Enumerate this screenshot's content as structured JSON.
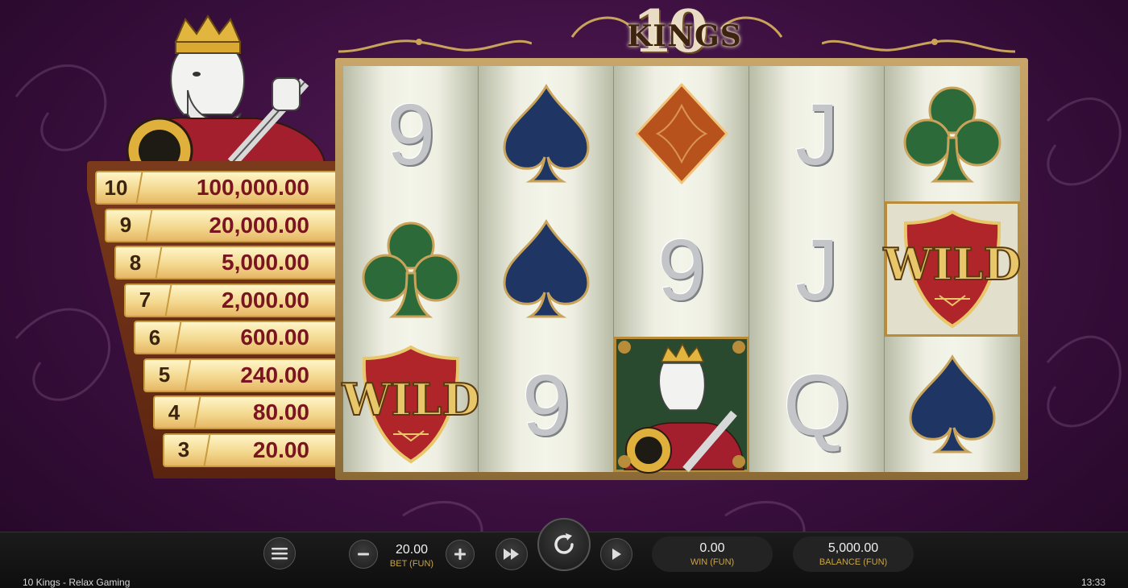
{
  "logo": {
    "number": "10",
    "word": "KINGS"
  },
  "paytable": [
    {
      "count": "10",
      "payout": "100,000.00"
    },
    {
      "count": "9",
      "payout": "20,000.00"
    },
    {
      "count": "8",
      "payout": "5,000.00"
    },
    {
      "count": "7",
      "payout": "2,000.00"
    },
    {
      "count": "6",
      "payout": "600.00"
    },
    {
      "count": "5",
      "payout": "240.00"
    },
    {
      "count": "4",
      "payout": "80.00"
    },
    {
      "count": "3",
      "payout": "20.00"
    }
  ],
  "reels": [
    [
      "9",
      "club",
      "wild"
    ],
    [
      "spade",
      "spade",
      "9"
    ],
    [
      "diamond",
      "9",
      "king"
    ],
    [
      "J",
      "J",
      "Q"
    ],
    [
      "club",
      "wild",
      "spade"
    ]
  ],
  "wild_label": "WILD",
  "symbol_colors": {
    "spade": "#1f3563",
    "club": "#2d6a3a",
    "diamond": "#b7521c",
    "wild_shield": "#b0252a",
    "wild_text": "#e8c66a"
  },
  "controls": {
    "menu_icon": "hamburger-icon",
    "bet_value": "20.00",
    "bet_label": "BET (FUN)",
    "win_value": "0.00",
    "win_label": "WIN (FUN)",
    "balance_value": "5,000.00",
    "balance_label": "BALANCE (FUN)"
  },
  "footer": {
    "title": "10 Kings - Relax Gaming",
    "clock": "13:33"
  }
}
